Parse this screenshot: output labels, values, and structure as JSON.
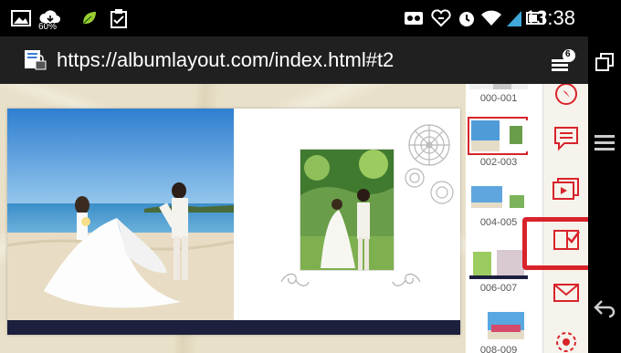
{
  "status_bar": {
    "battery_percent": "60%",
    "time": "13:38"
  },
  "browser": {
    "url": "https://albumlayout.com/index.html#t2",
    "tabs_count": "6"
  },
  "thumbnails": [
    {
      "label": "000-001"
    },
    {
      "label": "002-003"
    },
    {
      "label": "004-005"
    },
    {
      "label": "006-007"
    },
    {
      "label": "008-009"
    }
  ],
  "colors": {
    "accent_red": "#d8232a",
    "page_footer": "#1c1f3d",
    "background_marble": "#e8e0c8"
  },
  "icons": {
    "status": [
      "image-icon",
      "cloud-download-icon",
      "leaf-icon",
      "clipboard-check-icon",
      "voicemail-icon",
      "heart-icon",
      "alarm-icon",
      "wifi-icon",
      "signal-icon",
      "battery-icon"
    ],
    "browser": [
      "page-lock-icon",
      "tabs-menu-icon",
      "window-icon"
    ],
    "tools": [
      "compass-icon",
      "comment-icon",
      "slideshow-icon",
      "order-check-icon",
      "mail-icon",
      "settings-icon"
    ],
    "nav": [
      "menu-icon",
      "back-icon"
    ]
  }
}
